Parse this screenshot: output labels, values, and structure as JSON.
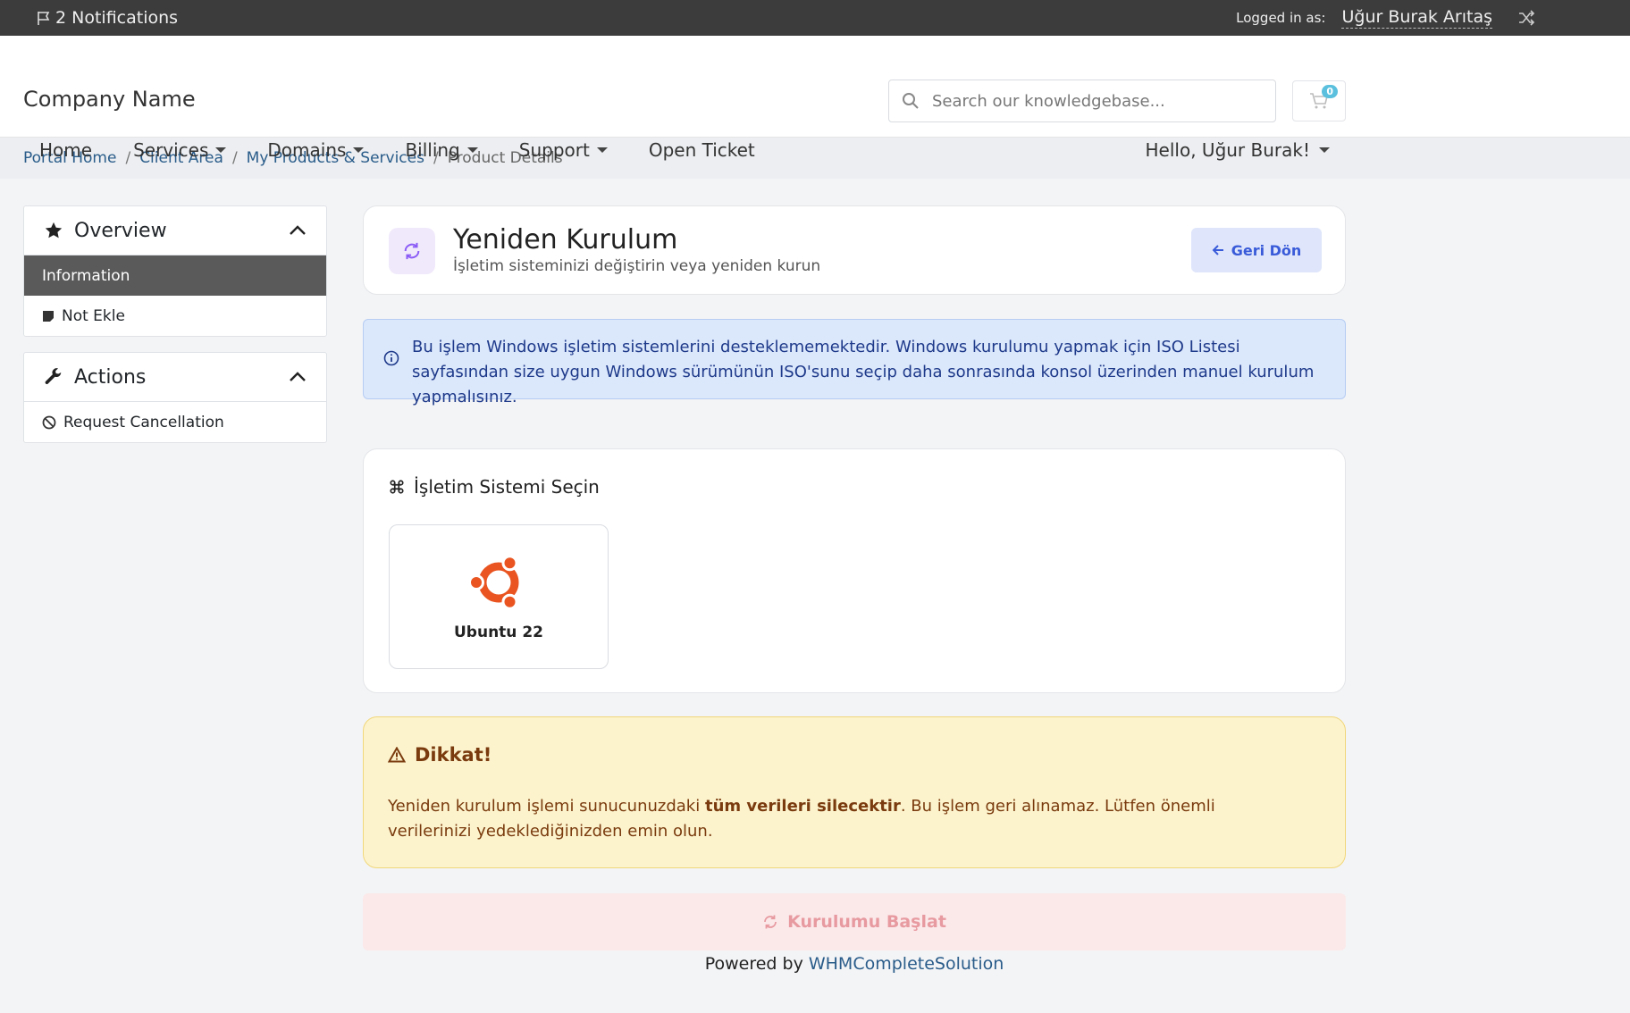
{
  "topbar": {
    "notifications": "2 Notifications",
    "logged_in_label": "Logged in as:",
    "user_name": "Uğur Burak Arıtaş"
  },
  "header": {
    "brand": "Company Name",
    "search_placeholder": "Search our knowledgebase...",
    "cart_count": "0"
  },
  "nav": {
    "items": [
      "Home",
      "Services",
      "Domains",
      "Billing",
      "Support",
      "Open Ticket"
    ],
    "hello": "Hello, Uğur Burak!"
  },
  "breadcrumb": [
    "Portal Home",
    "Client Area",
    "My Products & Services",
    "Product Details"
  ],
  "sidebar": {
    "overview": {
      "title": "Overview",
      "items": [
        "Information",
        "Not Ekle"
      ]
    },
    "actions": {
      "title": "Actions",
      "items": [
        "Request Cancellation"
      ]
    }
  },
  "main": {
    "title": "Yeniden Kurulum",
    "subtitle": "İşletim sisteminizi değiştirin veya yeniden kurun",
    "back_label": "Geri Dön",
    "info_text": "Bu işlem Windows işletim sistemlerini desteklememektedir. Windows kurulumu yapmak için ISO Listesi sayfasından size uygun Windows sürümünün ISO'sunu seçip daha sonrasında konsol üzerinden manuel kurulum yapmalısınız.",
    "os_section_title": "İşletim Sistemi Seçin",
    "os_options": [
      "Ubuntu 22"
    ],
    "warning_title": "Dikkat!",
    "warning_pre": "Yeniden kurulum işlemi sunucunuzdaki ",
    "warning_bold": "tüm verileri silecektir",
    "warning_post": ". Bu işlem geri alınamaz. Lütfen önemli verilerinizi yedeklediğinizden emin olun.",
    "start_label": "Kurulumu Başlat"
  },
  "footer": {
    "prefix": "Powered by ",
    "link": "WHMCompleteSolution"
  },
  "colors": {
    "accent_purple": "#8b5cf6",
    "ubuntu_orange": "#e95420",
    "info_blue": "#1e3a8a",
    "warn_brown": "#7a3b0e"
  }
}
